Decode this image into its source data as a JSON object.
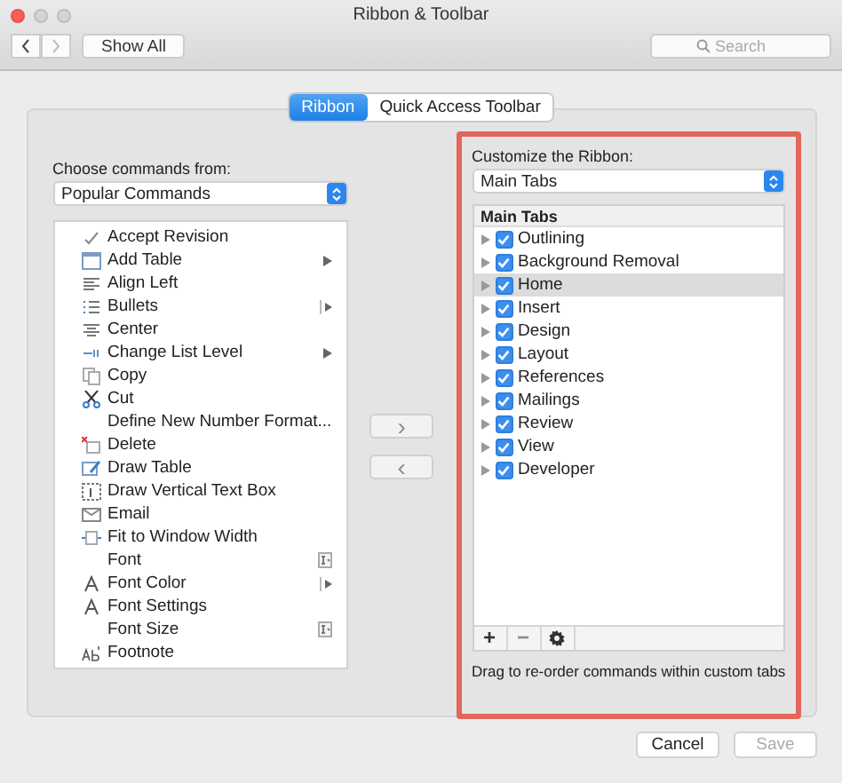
{
  "window": {
    "title": "Ribbon & Toolbar"
  },
  "toolbar": {
    "show_all": "Show All",
    "search": {
      "placeholder": "Search"
    }
  },
  "tabs": [
    {
      "label": "Ribbon",
      "selected": true
    },
    {
      "label": "Quick Access Toolbar",
      "selected": false
    }
  ],
  "commands": {
    "label": "Choose commands from:",
    "select": "Popular Commands",
    "items": [
      {
        "label": "Accept Revision",
        "kind": "plain"
      },
      {
        "label": "Add Table",
        "kind": "submenu"
      },
      {
        "label": "Align Left",
        "kind": "plain"
      },
      {
        "label": "Bullets",
        "kind": "split"
      },
      {
        "label": "Center",
        "kind": "plain"
      },
      {
        "label": "Change List Level",
        "kind": "submenu"
      },
      {
        "label": "Copy",
        "kind": "plain"
      },
      {
        "label": "Cut",
        "kind": "plain"
      },
      {
        "label": "Define New Number Format...",
        "kind": "plain"
      },
      {
        "label": "Delete",
        "kind": "plain"
      },
      {
        "label": "Draw Table",
        "kind": "plain"
      },
      {
        "label": "Draw Vertical Text Box",
        "kind": "plain"
      },
      {
        "label": "Email",
        "kind": "plain"
      },
      {
        "label": "Fit to Window Width",
        "kind": "plain"
      },
      {
        "label": "Font",
        "kind": "spin"
      },
      {
        "label": "Font Color",
        "kind": "split"
      },
      {
        "label": "Font Settings",
        "kind": "plain"
      },
      {
        "label": "Font Size",
        "kind": "spin"
      },
      {
        "label": "Footnote",
        "kind": "plain"
      }
    ]
  },
  "move_buttons": [
    {
      "glyph": "›",
      "disabled": true
    },
    {
      "glyph": "‹",
      "disabled": true
    }
  ],
  "ribbon": {
    "label": "Customize the Ribbon:",
    "select": "Main Tabs",
    "header": "Main Tabs",
    "tabs": [
      {
        "label": "Outlining",
        "checked": true,
        "selected": false
      },
      {
        "label": "Background Removal",
        "checked": true,
        "selected": false
      },
      {
        "label": "Home",
        "checked": true,
        "selected": true
      },
      {
        "label": "Insert",
        "checked": true,
        "selected": false
      },
      {
        "label": "Design",
        "checked": true,
        "selected": false
      },
      {
        "label": "Layout",
        "checked": true,
        "selected": false
      },
      {
        "label": "References",
        "checked": true,
        "selected": false
      },
      {
        "label": "Mailings",
        "checked": true,
        "selected": false
      },
      {
        "label": "Review",
        "checked": true,
        "selected": false
      },
      {
        "label": "View",
        "checked": true,
        "selected": false
      },
      {
        "label": "Developer",
        "checked": true,
        "selected": false
      }
    ],
    "add": "+",
    "remove": "−",
    "remove_disabled": true,
    "hint": "Drag to re-order commands within custom tabs"
  },
  "footer": {
    "buttons": [
      {
        "label": "Cancel",
        "disabled": false
      },
      {
        "label": "Save",
        "disabled": true
      }
    ]
  }
}
